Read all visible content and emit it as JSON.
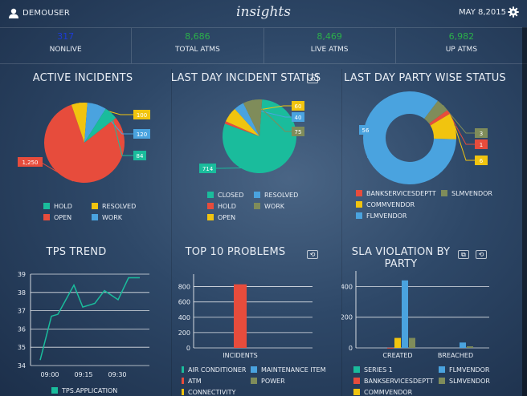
{
  "header": {
    "user": "DEMOUSER",
    "title": "insights",
    "date": "MAY 8,2015"
  },
  "kpis": [
    {
      "value": "317",
      "label": "NONLIVE",
      "color": "#1d3bd6"
    },
    {
      "value": "8,686",
      "label": "TOTAL ATMS",
      "color": "#2bb04a"
    },
    {
      "value": "8,469",
      "label": "LIVE ATMS",
      "color": "#2bb04a"
    },
    {
      "value": "6,982",
      "label": "UP ATMS",
      "color": "#2bb04a"
    }
  ],
  "panels": {
    "active_incidents": "ACTIVE INCIDENTS",
    "last_day_status": "LAST DAY INCIDENT STATUS",
    "party_status": "LAST DAY PARTY WISE STATUS",
    "tps_trend": "TPS TREND",
    "top10": "TOP 10 PROBLEMS",
    "sla": "SLA VIOLATION BY PARTY"
  },
  "colors": {
    "teal": "#1abc9c",
    "red": "#e74c3c",
    "yellow": "#f1c40f",
    "blue": "#4aa3df",
    "olive": "#7f8c5a"
  },
  "chart_data": [
    {
      "type": "pie",
      "title": "ACTIVE INCIDENTS",
      "slices": [
        {
          "name": "OPEN",
          "value": 1250,
          "label": "1,250",
          "color": "#e74c3c"
        },
        {
          "name": "RESOLVED",
          "value": 100,
          "label": "100",
          "color": "#f1c40f"
        },
        {
          "name": "WORK",
          "value": 120,
          "label": "120",
          "color": "#4aa3df"
        },
        {
          "name": "HOLD",
          "value": 84,
          "label": "84",
          "color": "#1abc9c"
        }
      ],
      "legend": [
        [
          "HOLD",
          "RESOLVED"
        ],
        [
          "OPEN",
          "WORK"
        ]
      ]
    },
    {
      "type": "pie",
      "title": "LAST DAY INCIDENT STATUS",
      "slices": [
        {
          "name": "CLOSED",
          "value": 714,
          "label": "714",
          "color": "#1abc9c"
        },
        {
          "name": "HOLD",
          "value": 10,
          "label": "",
          "color": "#e74c3c"
        },
        {
          "name": "OPEN",
          "value": 60,
          "label": "60",
          "color": "#f1c40f"
        },
        {
          "name": "RESOLVED",
          "value": 40,
          "label": "40",
          "color": "#4aa3df"
        },
        {
          "name": "WORK",
          "value": 75,
          "label": "75",
          "color": "#7f8c5a"
        }
      ],
      "legend": [
        [
          "CLOSED",
          "RESOLVED"
        ],
        [
          "HOLD",
          "WORK"
        ],
        [
          "OPEN"
        ]
      ]
    },
    {
      "type": "pie",
      "title": "LAST DAY PARTY WISE STATUS",
      "donut": true,
      "slices": [
        {
          "name": "FLMVENDOR",
          "value": 56,
          "label": "56",
          "color": "#4aa3df"
        },
        {
          "name": "SLMVENDOR",
          "value": 3,
          "label": "3",
          "color": "#7f8c5a"
        },
        {
          "name": "BANKSERVICESDEPTT",
          "value": 1,
          "label": "1",
          "color": "#e74c3c"
        },
        {
          "name": "COMMVENDOR",
          "value": 6,
          "label": "6",
          "color": "#f1c40f"
        }
      ],
      "legend": [
        [
          "BANKSERVICESDEPTT",
          "SLMVENDOR"
        ],
        [
          "COMMVENDOR"
        ],
        [
          "FLMVENDOR"
        ]
      ]
    },
    {
      "type": "line",
      "title": "TPS TREND",
      "x": [
        "08:50",
        "08:55",
        "08:58",
        "09:02",
        "09:07",
        "09:12",
        "09:15",
        "09:20",
        "09:25",
        "09:30",
        "09:35",
        "09:40",
        "09:45"
      ],
      "xticks": [
        "09:00",
        "09:15",
        "09:30"
      ],
      "series": [
        {
          "name": "TPS.APPLICATION",
          "color": "#1abc9c",
          "values": [
            34.3,
            36.7,
            36.8,
            38.4,
            37.2,
            37.4,
            38.1,
            37.6,
            38.8,
            38.8
          ]
        }
      ],
      "ylim": [
        34,
        39
      ],
      "yticks": [
        34,
        35,
        36,
        37,
        38,
        39
      ]
    },
    {
      "type": "bar",
      "title": "TOP 10 PROBLEMS",
      "categories": [
        "INCIDENTS"
      ],
      "series": [
        {
          "name": "ATM",
          "values": [
            830
          ],
          "color": "#e74c3c"
        }
      ],
      "ylim": [
        0,
        900
      ],
      "yticks": [
        0,
        200,
        400,
        600,
        800
      ],
      "legend": [
        [
          "AIR CONDITIONER",
          "#1abc9c"
        ],
        [
          "MAINTENANCE ITEM",
          "#4aa3df"
        ],
        [
          "ATM",
          "#e74c3c"
        ],
        [
          "POWER",
          "#7f8c5a"
        ],
        [
          "CONNECTIVITY",
          "#f1c40f"
        ]
      ]
    },
    {
      "type": "bar",
      "title": "SLA VIOLATION BY PARTY",
      "categories": [
        "CREATED",
        "BREACHED"
      ],
      "series": [
        {
          "name": "SERIES 1",
          "color": "#1abc9c",
          "values": [
            0,
            0
          ]
        },
        {
          "name": "BANKSERVICESDEPTT",
          "color": "#e74c3c",
          "values": [
            1,
            0
          ]
        },
        {
          "name": "COMMVENDOR",
          "color": "#f1c40f",
          "values": [
            65,
            0
          ]
        },
        {
          "name": "FLMVENDOR",
          "color": "#4aa3df",
          "values": [
            440,
            35
          ]
        },
        {
          "name": "SLMVENDOR",
          "color": "#7f8c5a",
          "values": [
            65,
            10
          ]
        }
      ],
      "ylim": [
        0,
        470
      ],
      "yticks": [
        0,
        200,
        400
      ]
    }
  ]
}
